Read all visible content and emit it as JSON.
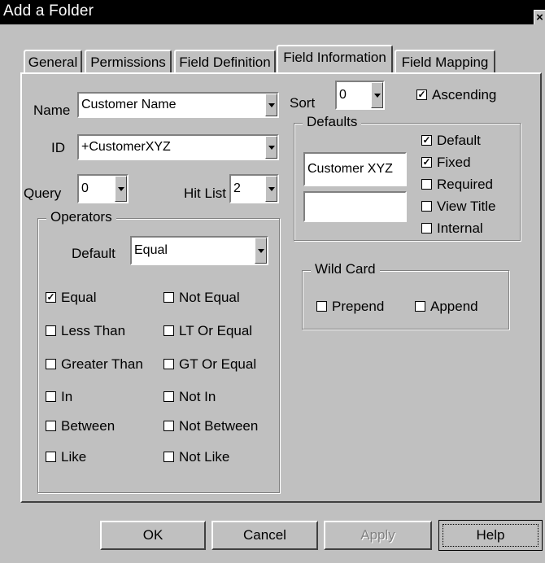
{
  "window": {
    "title": "Add a Folder",
    "close_glyph": "×"
  },
  "tabs": [
    "General",
    "Permissions",
    "Field Definition",
    "Field Information",
    "Field Mapping"
  ],
  "active_tab": "Field Information",
  "fields": {
    "name_label": "Name",
    "name_value": "Customer Name",
    "id_label": "ID",
    "id_value": "+CustomerXYZ",
    "query_label": "Query",
    "query_value": "0",
    "hitlist_label": "Hit List",
    "hitlist_value": "2",
    "sort_label": "Sort",
    "sort_value": "0"
  },
  "ascending": {
    "label": "Ascending",
    "checked": true
  },
  "defaults_group": {
    "title": "Defaults",
    "value1": "Customer XYZ",
    "value2": "",
    "options": [
      {
        "label": "Default",
        "checked": true
      },
      {
        "label": "Fixed",
        "checked": true
      },
      {
        "label": "Required",
        "checked": false
      },
      {
        "label": "View Title",
        "checked": false
      },
      {
        "label": "Internal",
        "checked": false
      }
    ]
  },
  "operators_group": {
    "title": "Operators",
    "default_label": "Default",
    "default_value": "Equal",
    "left": [
      {
        "label": "Equal",
        "checked": true
      },
      {
        "label": "Less Than",
        "checked": false
      },
      {
        "label": "Greater Than",
        "checked": false
      },
      {
        "label": "In",
        "checked": false
      },
      {
        "label": "Between",
        "checked": false
      },
      {
        "label": "Like",
        "checked": false
      }
    ],
    "right": [
      {
        "label": "Not Equal",
        "checked": false
      },
      {
        "label": "LT Or Equal",
        "checked": false
      },
      {
        "label": "GT Or Equal",
        "checked": false
      },
      {
        "label": "Not In",
        "checked": false
      },
      {
        "label": "Not Between",
        "checked": false
      },
      {
        "label": "Not Like",
        "checked": false
      }
    ]
  },
  "wildcard_group": {
    "title": "Wild Card",
    "prepend": {
      "label": "Prepend",
      "checked": false
    },
    "append": {
      "label": "Append",
      "checked": false
    }
  },
  "buttons": {
    "ok": "OK",
    "cancel": "Cancel",
    "apply": "Apply",
    "help": "Help"
  },
  "glyphs": {
    "check": "✓"
  }
}
